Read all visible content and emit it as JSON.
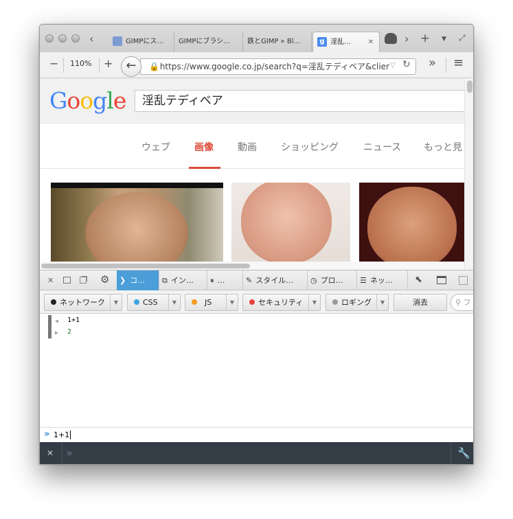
{
  "tabs": [
    {
      "label": "GIMPにス…",
      "favicon_color": "#7c9bd1"
    },
    {
      "label": "GIMPにブラシ…"
    },
    {
      "label": "鉄とGIMP » Bl…"
    },
    {
      "label": "淫乱…",
      "favicon": "g",
      "favicon_color": "#4a8cf0"
    }
  ],
  "tab_close": "✕",
  "nav": {
    "zoom_minus": "−",
    "zoom_level": "110%",
    "zoom_plus": "+",
    "back": "←",
    "url": "https://www.google.co.jp/search?q=淫乱テディベア&clier",
    "overflow": "»",
    "menu": "≡"
  },
  "google": {
    "query": "淫乱テディベア",
    "tabs": [
      "ウェブ",
      "画像",
      "動画",
      "ショッピング",
      "ニュース",
      "もっと見"
    ],
    "active_tab": "画像"
  },
  "devtools": {
    "tabs": [
      "コ…",
      "イン…",
      "…",
      "スタイル…",
      "プロ…",
      "ネッ…"
    ],
    "filters": [
      {
        "label": "ネットワーク",
        "color": "#222222"
      },
      {
        "label": "CSS",
        "color": "#3ba4de"
      },
      {
        "label": "JS",
        "color": "#f39c1f"
      },
      {
        "label": "セキュリティ",
        "color": "#e8413f"
      },
      {
        "label": "ロギング",
        "color": "#9a9a9a"
      }
    ],
    "clear_label": "消去",
    "filter_placeholder": "フ",
    "console": {
      "input": "1+1",
      "output": "2"
    },
    "prompt_value": "1+1",
    "bottom_prompt": "»"
  },
  "colors": {
    "accent": "#4c9ed9",
    "google_red": "#dd4b39",
    "result_green": "#2a7a2a"
  }
}
